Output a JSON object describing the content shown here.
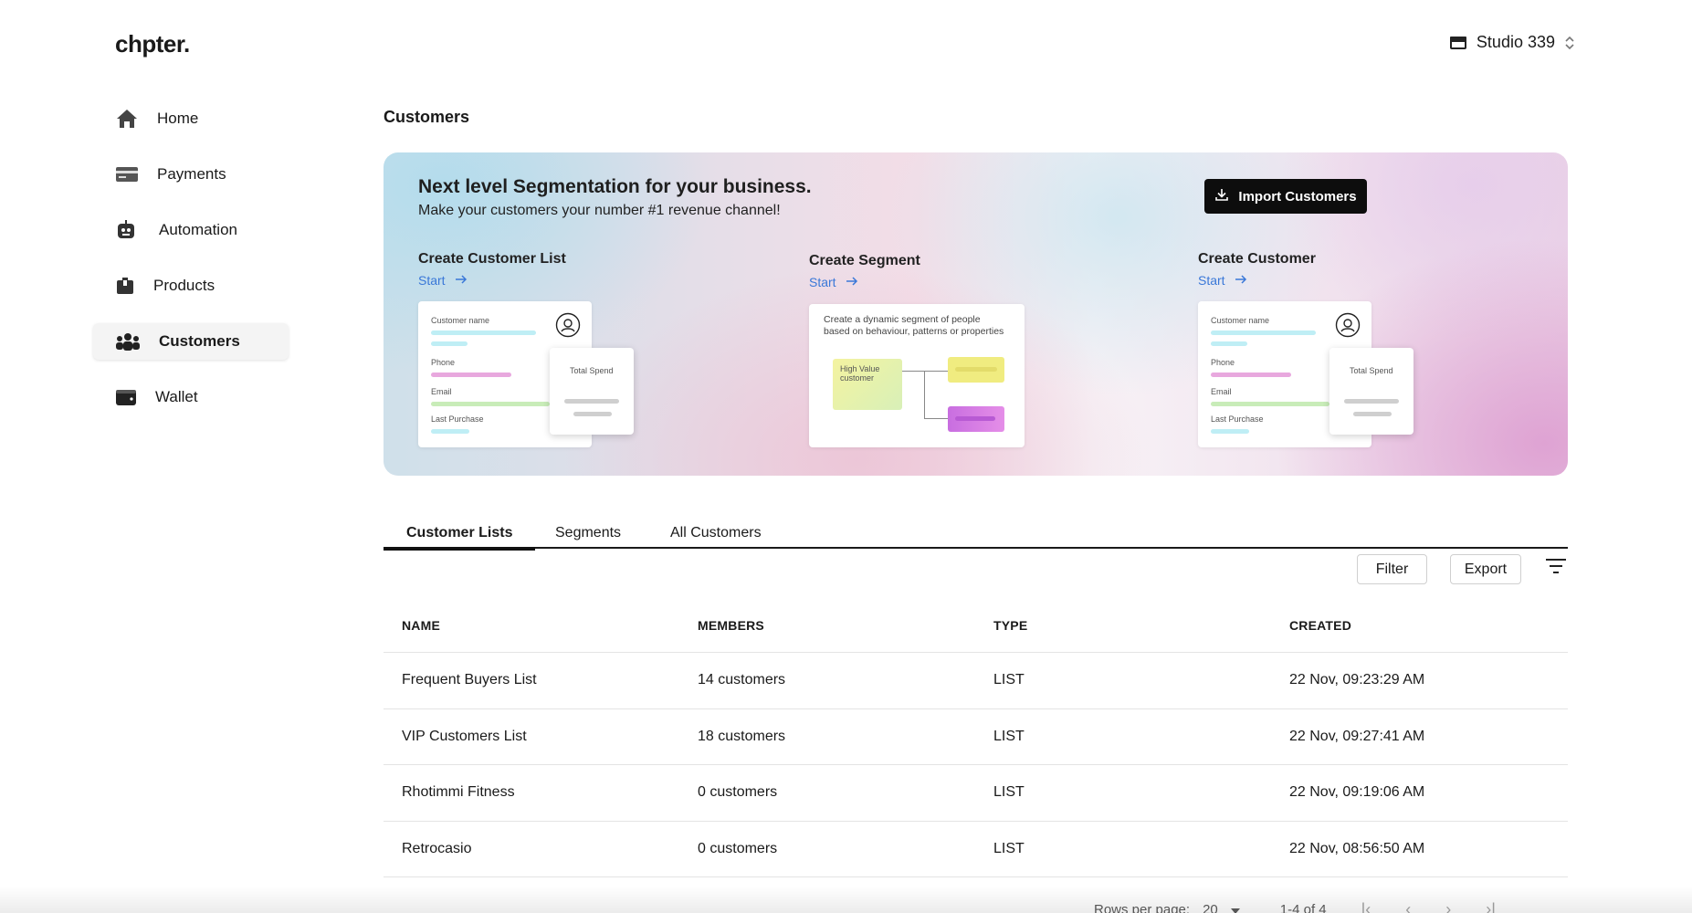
{
  "app": {
    "logo": "chpter.",
    "store_name": "Studio 339"
  },
  "sidebar": {
    "items": [
      {
        "label": "Home",
        "icon": "home-icon"
      },
      {
        "label": "Payments",
        "icon": "card-icon"
      },
      {
        "label": "Automation",
        "icon": "robot-icon"
      },
      {
        "label": "Products",
        "icon": "box-icon"
      },
      {
        "label": "Customers",
        "icon": "people-icon",
        "active": true
      },
      {
        "label": "Wallet",
        "icon": "wallet-icon"
      }
    ]
  },
  "page": {
    "title": "Customers"
  },
  "banner": {
    "heading": "Next level Segmentation for your business.",
    "subheading": "Make your customers your number #1 revenue channel!",
    "import_label": "Import Customers",
    "cards": [
      {
        "title": "Create Customer List",
        "start": "Start"
      },
      {
        "title": "Create Segment",
        "start": "Start"
      },
      {
        "title": "Create Customer",
        "start": "Start"
      }
    ],
    "mock_list": {
      "name": "Customer name",
      "phone": "Phone",
      "email": "Email",
      "last_purchase": "Last Purchase",
      "total_spend": "Total Spend"
    },
    "mock_segment": {
      "description": "Create a dynamic segment of people based on behaviour, patterns or properties",
      "node": "High Value customer"
    }
  },
  "tabs": [
    {
      "label": "Customer Lists",
      "active": true
    },
    {
      "label": "Segments"
    },
    {
      "label": "All Customers"
    }
  ],
  "toolbar": {
    "filter_label": "Filter",
    "export_label": "Export"
  },
  "table": {
    "headers": [
      "NAME",
      "MEMBERS",
      "TYPE",
      "CREATED"
    ],
    "rows": [
      [
        "Frequent Buyers List",
        "14 customers",
        "LIST",
        "22 Nov, 09:23:29 AM"
      ],
      [
        "VIP Customers List",
        "18 customers",
        "LIST",
        "22 Nov, 09:27:41 AM"
      ],
      [
        "Rhotimmi Fitness",
        "0 customers",
        "LIST",
        "22 Nov, 09:19:06 AM"
      ],
      [
        "Retrocasio",
        "0 customers",
        "LIST",
        "22 Nov, 08:56:50 AM"
      ]
    ]
  },
  "pagination": {
    "rows_per_page_label": "Rows per page:",
    "rows_per_page": "20",
    "range": "1-4 of 4"
  }
}
